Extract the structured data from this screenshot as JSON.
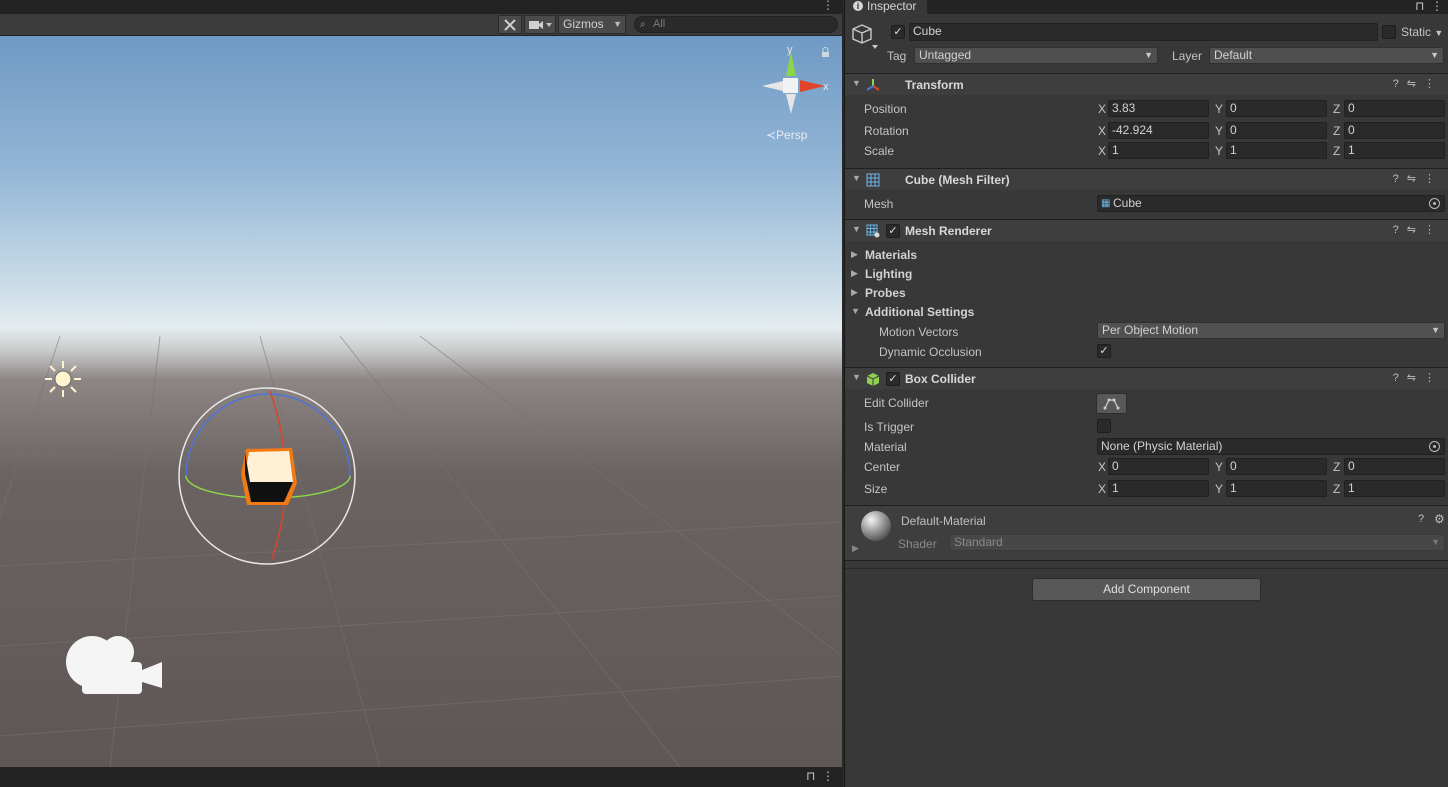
{
  "scene": {
    "toolbar": {
      "tools_icon": "tools-icon",
      "camera_icon": "video-camera-icon",
      "gizmos_label": "Gizmos",
      "search_placeholder": "All"
    },
    "gizmo": {
      "y_label": "y",
      "x_label": "x",
      "persp_label": "≺Persp"
    },
    "icons": [
      "sun-icon",
      "camera-gizmo-icon",
      "lock-icon",
      "menu-dots-icon"
    ]
  },
  "inspector": {
    "tab_label": "Inspector",
    "object": {
      "name": "Cube",
      "active": true,
      "static_label": "Static",
      "tag_label": "Tag",
      "tag_value": "Untagged",
      "layer_label": "Layer",
      "layer_value": "Default"
    },
    "transform": {
      "title": "Transform",
      "position": {
        "label": "Position",
        "x": "3.83",
        "y": "0",
        "z": "0"
      },
      "rotation": {
        "label": "Rotation",
        "x": "-42.924",
        "y": "0",
        "z": "0"
      },
      "scale": {
        "label": "Scale",
        "x": "1",
        "y": "1",
        "z": "1"
      }
    },
    "mesh_filter": {
      "title": "Cube (Mesh Filter)",
      "mesh_label": "Mesh",
      "mesh_value": "Cube"
    },
    "mesh_renderer": {
      "title": "Mesh Renderer",
      "enabled": true,
      "foldouts": [
        "Materials",
        "Lighting",
        "Probes",
        "Additional Settings"
      ],
      "motion_vectors_label": "Motion Vectors",
      "motion_vectors_value": "Per Object Motion",
      "dynamic_occlusion_label": "Dynamic Occlusion",
      "dynamic_occlusion": true
    },
    "box_collider": {
      "title": "Box Collider",
      "enabled": true,
      "edit_collider_label": "Edit Collider",
      "is_trigger_label": "Is Trigger",
      "is_trigger": false,
      "material_label": "Material",
      "material_value": "None (Physic Material)",
      "center": {
        "label": "Center",
        "x": "0",
        "y": "0",
        "z": "0"
      },
      "size": {
        "label": "Size",
        "x": "1",
        "y": "1",
        "z": "1"
      }
    },
    "material": {
      "name": "Default-Material",
      "shader_label": "Shader",
      "shader_value": "Standard"
    },
    "axis_labels": {
      "x": "X",
      "y": "Y",
      "z": "Z"
    },
    "add_component_label": "Add Component"
  }
}
